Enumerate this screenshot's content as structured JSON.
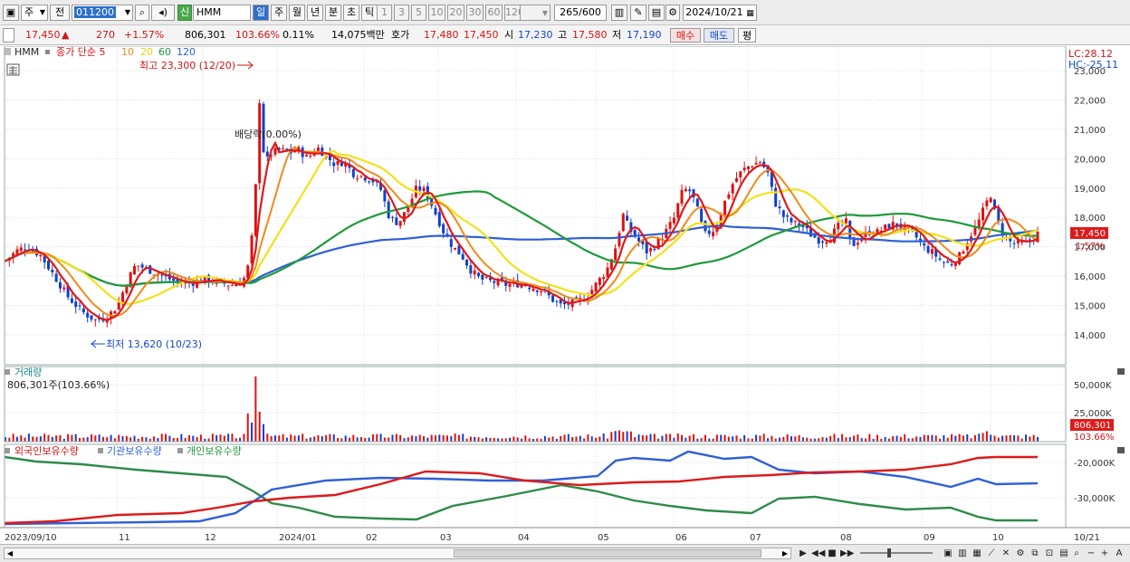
{
  "toolbar": {
    "type_label": "주",
    "prev_label": "전",
    "stock_code": "011200",
    "stock_badge": "신",
    "stock_name": "HMM",
    "periods": [
      "일",
      "주",
      "월",
      "년",
      "분",
      "초",
      "틱"
    ],
    "period_active": "일",
    "intervals": [
      "1",
      "3",
      "5",
      "10",
      "20",
      "30",
      "60",
      "120"
    ],
    "bar_count": "265",
    "bar_total": "/600",
    "date": "2024/10/21"
  },
  "quote": {
    "price": "17,450",
    "arrow": "▲",
    "change": "270",
    "change_pct": "+1.57%",
    "volume": "806,301",
    "volume_ratio": "103.66%",
    "turnover": "0.11%",
    "amount": "14,075백만",
    "ask_label": "호가",
    "ask1": "17,480",
    "ask2": "17,450",
    "open_label": "시",
    "open": "17,230",
    "high_label": "고",
    "high": "17,580",
    "low_label": "저",
    "low": "17,190",
    "buy_label": "매수",
    "sell_label": "매도",
    "eval_label": "평"
  },
  "price_pane": {
    "legend_name": "HMM",
    "legend_ma": "종가 단순 5",
    "ma_periods": [
      "10",
      "20",
      "60",
      "120"
    ],
    "lc": "LC:28.12",
    "hc": "HC:-25.11",
    "high_note": "최고 23,300 (12/20)",
    "low_note": "최저 13,620 (10/23)",
    "dividend_note": "배당락(0.00%)",
    "last_price_label": "17,450",
    "last_pct_label": "1.57%",
    "yticks": [
      "23,000",
      "22,000",
      "21,000",
      "20,000",
      "19,000",
      "18,000",
      "17,000",
      "16,000",
      "15,000",
      "14,000"
    ]
  },
  "volume_pane": {
    "title": "거래량",
    "value": "806,301주(103.66%)",
    "yticks": [
      "50,000K",
      "25,000K"
    ],
    "last_label": "806,301",
    "last_pct": "103.66%"
  },
  "holdings_pane": {
    "legends": [
      "외국인보유수량",
      "기관보유수량",
      "개인보유수량"
    ],
    "yticks": [
      "-20,000K",
      "-30,000K"
    ]
  },
  "x_axis": {
    "labels": [
      "2023/09/10",
      "11",
      "12",
      "2024/01",
      "02",
      "03",
      "04",
      "05",
      "06",
      "07",
      "08",
      "09",
      "10",
      "10/21"
    ]
  },
  "colors": {
    "ma5": "#dd1a1a",
    "ma10": "#f08a1a",
    "ma20": "#f2e21a",
    "ma60": "#1f9a3a",
    "ma120": "#2f5fd8",
    "up": "#e01010",
    "down": "#1040d0"
  }
}
